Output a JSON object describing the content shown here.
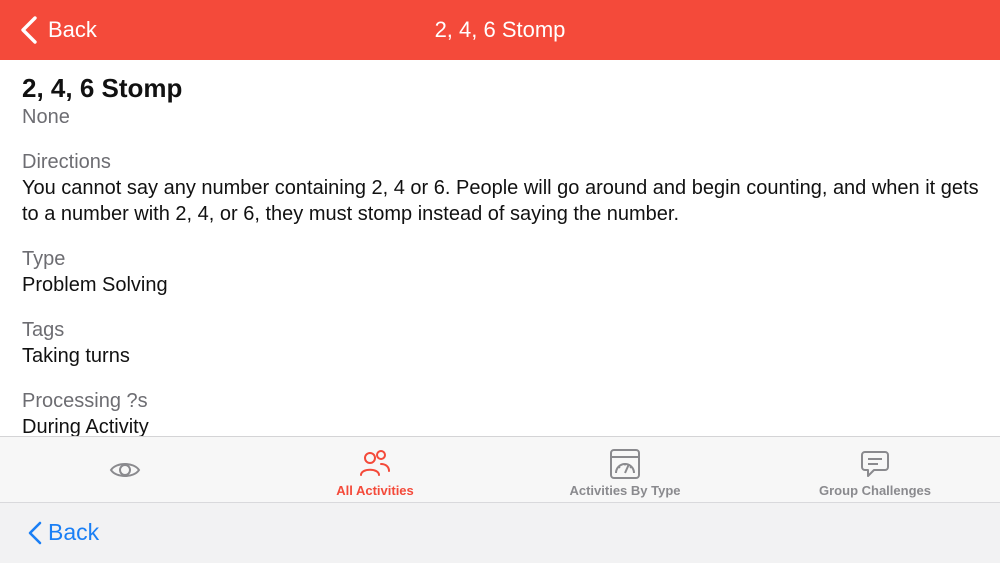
{
  "navbar": {
    "back_label": "Back",
    "title": "2, 4, 6 Stomp",
    "color": "#f44a3a"
  },
  "activity": {
    "title": "2, 4, 6 Stomp",
    "subtitle": "None",
    "sections": [
      {
        "label": "Directions",
        "value": "You cannot say any number containing 2, 4 or 6. People will go around and begin counting, and when it gets to a number with 2, 4, or 6, they must stomp instead of saying the number."
      },
      {
        "label": "Type",
        "value": "Problem Solving"
      },
      {
        "label": "Tags",
        "value": "Taking turns"
      },
      {
        "label": "Processing ?s",
        "value": "During Activity"
      }
    ]
  },
  "tabbar": {
    "tabs": [
      {
        "label": "",
        "icon": "eye-icon",
        "active": false
      },
      {
        "label": "All Activities",
        "icon": "people-icon",
        "active": true
      },
      {
        "label": "Activities By Type",
        "icon": "dashboard-gauge-icon",
        "active": false
      },
      {
        "label": "Group Challenges",
        "icon": "speech-bubble-icon",
        "active": false
      }
    ],
    "active_color": "#f44a3a",
    "inactive_color": "#8a8a8e"
  },
  "bottombar": {
    "back_label": "Back",
    "color": "#1a7ff5"
  }
}
